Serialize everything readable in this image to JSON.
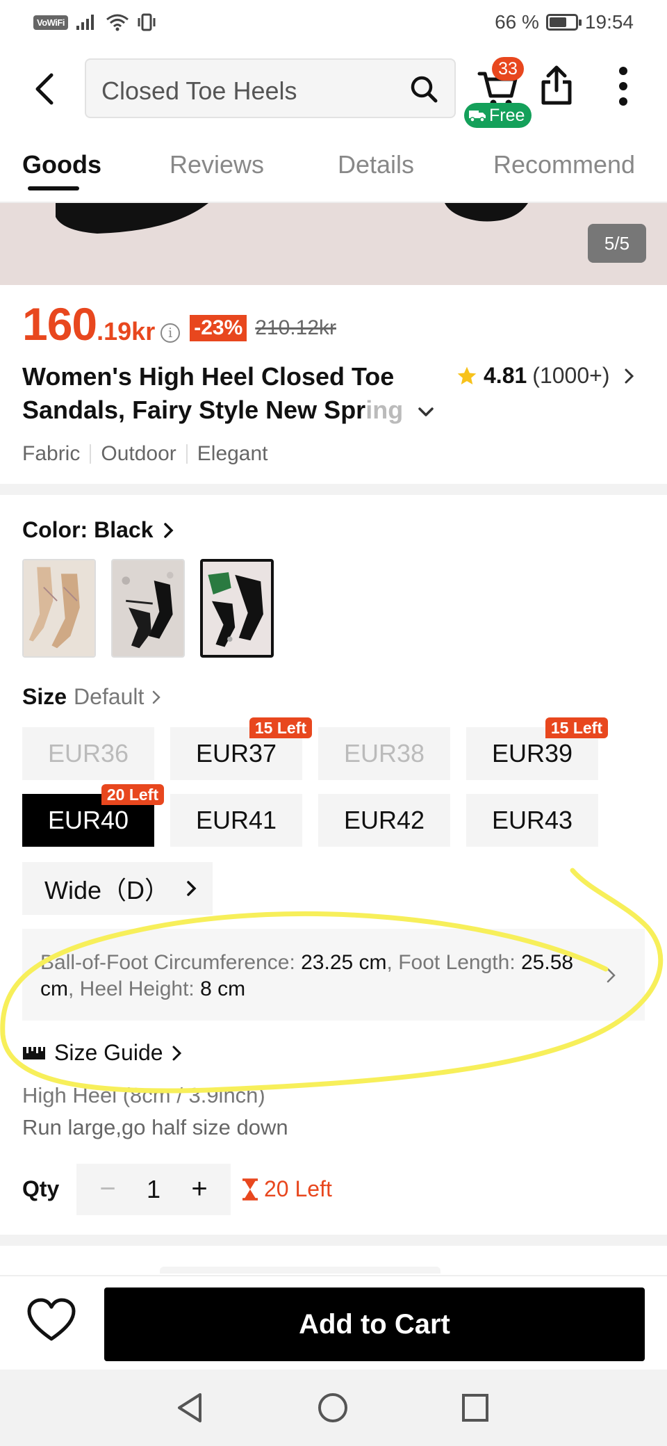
{
  "status_bar": {
    "vowifi": "VoWiFi",
    "battery": "66 %",
    "battery_level": 0.66,
    "time": "19:54"
  },
  "header": {
    "search_value": "Closed Toe Heels",
    "cart_count": "33",
    "free_label": "Free"
  },
  "tabs": [
    "Goods",
    "Reviews",
    "Details",
    "Recommend"
  ],
  "gallery": {
    "counter": "5/5"
  },
  "price": {
    "main": "160",
    "decimal": ".19kr",
    "info_symbol": "i",
    "discount": "-23%",
    "original": "210.12kr"
  },
  "product": {
    "title_line1": "Women's High Heel Closed Toe",
    "title_line2": "Sandals, Fairy Style New Spr",
    "title_fade": "ing",
    "rating": "4.81",
    "review_count": "(1000+)",
    "tags": [
      "Fabric",
      "Outdoor",
      "Elegant"
    ]
  },
  "color": {
    "label": "Color: Black",
    "swatches": [
      "nude-lace-up",
      "black-pointed-studded",
      "black-ankle-strap"
    ],
    "selected_index": 2
  },
  "size": {
    "label": "Size",
    "default": "Default",
    "options": [
      {
        "label": "EUR36",
        "state": "disabled",
        "badge": ""
      },
      {
        "label": "EUR37",
        "state": "available",
        "badge": "15 Left"
      },
      {
        "label": "EUR38",
        "state": "disabled",
        "badge": ""
      },
      {
        "label": "EUR39",
        "state": "available",
        "badge": "15 Left"
      },
      {
        "label": "EUR40",
        "state": "selected",
        "badge": "20 Left"
      },
      {
        "label": "EUR41",
        "state": "available",
        "badge": ""
      },
      {
        "label": "EUR42",
        "state": "available",
        "badge": ""
      },
      {
        "label": "EUR43",
        "state": "available",
        "badge": ""
      }
    ],
    "width": "Wide（D）"
  },
  "measurements": {
    "k1": "Ball-of-Foot Circumference: ",
    "v1": "23.25 cm",
    "k2": ", Foot Length: ",
    "v2": "25.58 cm",
    "k3": ", Heel Height: ",
    "v3": "8 cm"
  },
  "size_guide": {
    "label": "Size Guide",
    "heel_text": "High Heel (8cm / 3.9inch)",
    "fit_text": "Run large,go half size down"
  },
  "qty": {
    "label": "Qty",
    "minus": "−",
    "value": "1",
    "plus": "+",
    "stock": "20 Left"
  },
  "bottom": {
    "add_to_cart": "Add to Cart"
  },
  "colors": {
    "accent": "#e8471e",
    "free_green": "#14a05a",
    "annotation_yellow": "#f7ef5a"
  }
}
